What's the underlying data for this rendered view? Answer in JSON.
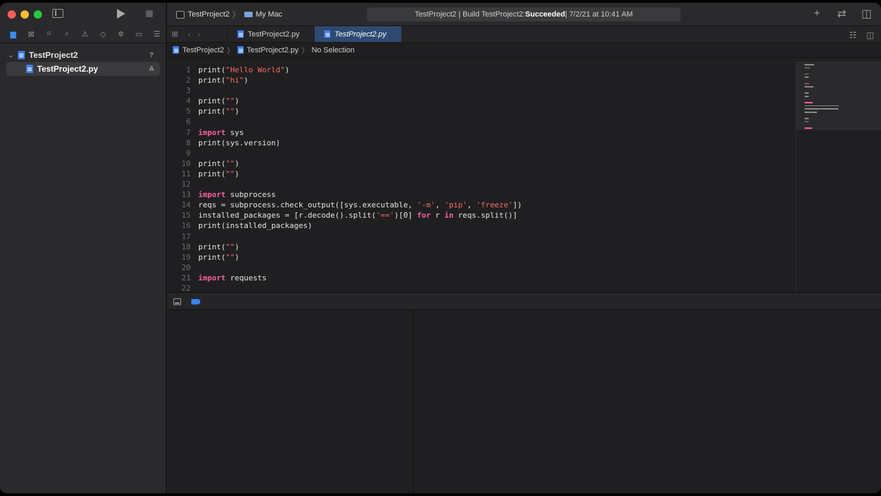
{
  "toolbar": {
    "scheme_name": "TestProject2",
    "destination": "My Mac",
    "activity_prefix": "TestProject2 | Build TestProject2: ",
    "activity_status": "Succeeded",
    "activity_suffix": " | 7/2/21 at 10:41 AM"
  },
  "navigator": {
    "project": "TestProject2",
    "project_badge": "?",
    "file": "TestProject2.py",
    "file_badge": "A"
  },
  "tabs": [
    {
      "label": "TestProject2.py"
    },
    {
      "label": "TestProject2.py"
    }
  ],
  "jumpbar": {
    "project": "TestProject2",
    "file": "TestProject2.py",
    "selection": "No Selection"
  },
  "code_lines": [
    "print(\"Hello World\")",
    "print(\"hi\")",
    "",
    "print(\"\")",
    "print(\"\")",
    "",
    "import sys",
    "print(sys.version)",
    "",
    "print(\"\")",
    "print(\"\")",
    "",
    "import subprocess",
    "reqs = subprocess.check_output([sys.executable, '-m', 'pip', 'freeze'])",
    "installed_packages = [r.decode().split('==')[0] for r in reqs.split()]",
    "print(installed_packages)",
    "",
    "print(\"\")",
    "print(\"\")",
    "",
    "import requests",
    ""
  ],
  "colors": {
    "keyword": "#fc5fa3",
    "string": "#fc6a5d",
    "accent": "#3b82f6"
  }
}
